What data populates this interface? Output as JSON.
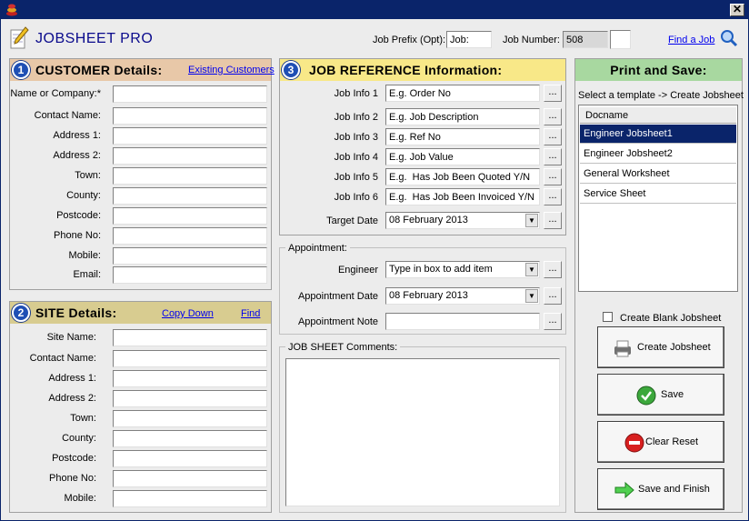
{
  "app": {
    "title": "JOBSHEET PRO",
    "close_glyph": "✕"
  },
  "header": {
    "job_prefix_label": "Job Prefix (Opt):",
    "job_prefix_value": "Job:",
    "job_number_label": "Job Number:",
    "job_number_value": "508",
    "find_job_link": "Find a Job"
  },
  "customer": {
    "badge": "1",
    "title": "CUSTOMER Details:",
    "existing_link": "Existing Customers",
    "fields": [
      {
        "label": "Name or Company:*",
        "value": ""
      },
      {
        "label": "Contact Name:",
        "value": ""
      },
      {
        "label": "Address 1:",
        "value": ""
      },
      {
        "label": "Address 2:",
        "value": ""
      },
      {
        "label": "Town:",
        "value": ""
      },
      {
        "label": "County:",
        "value": ""
      },
      {
        "label": "Postcode:",
        "value": ""
      },
      {
        "label": "Phone No:",
        "value": ""
      },
      {
        "label": "Mobile:",
        "value": ""
      },
      {
        "label": "Email:",
        "value": ""
      }
    ]
  },
  "site": {
    "badge": "2",
    "title": "SITE Details:",
    "copy_down_link": "Copy Down",
    "find_link": "Find",
    "fields": [
      {
        "label": "Site Name:",
        "value": ""
      },
      {
        "label": "Contact Name:",
        "value": ""
      },
      {
        "label": "Address 1:",
        "value": ""
      },
      {
        "label": "Address 2:",
        "value": ""
      },
      {
        "label": "Town:",
        "value": ""
      },
      {
        "label": "County:",
        "value": ""
      },
      {
        "label": "Postcode:",
        "value": ""
      },
      {
        "label": "Phone No:",
        "value": ""
      },
      {
        "label": "Mobile:",
        "value": ""
      }
    ]
  },
  "job_ref": {
    "badge": "3",
    "title": "JOB REFERENCE Information:",
    "dots_label": "...",
    "infos": [
      {
        "label": "Job Info 1",
        "value": "E.g. Order No"
      },
      {
        "label": "Job Info 2",
        "value": "E.g. Job Description"
      },
      {
        "label": "Job Info 3",
        "value": "E.g. Ref No"
      },
      {
        "label": "Job Info 4",
        "value": "E.g. Job Value"
      },
      {
        "label": "Job Info 5",
        "value": "E.g.  Has Job Been Quoted Y/N"
      },
      {
        "label": "Job Info 6",
        "value": "E.g.  Has Job Been Invoiced Y/N"
      }
    ],
    "target_date_label": "Target Date",
    "target_date_value": "08  February  2013"
  },
  "appointment": {
    "legend": "Appointment:",
    "engineer_label": "Engineer",
    "engineer_value": "Type in box to add item",
    "date_label": "Appointment Date",
    "date_value": "08  February  2013",
    "note_label": "Appointment Note",
    "note_value": ""
  },
  "comments": {
    "legend": "JOB SHEET Comments:",
    "value": ""
  },
  "print_save": {
    "title": "Print and Save:",
    "instruction": "Select a template -> Create Jobsheet",
    "list_header": "Docname",
    "templates": [
      "Engineer Jobsheet1",
      "Engineer Jobsheet2",
      "General Worksheet",
      "Service Sheet"
    ],
    "selected_index": 0,
    "blank_checkbox_label": "Create Blank Jobsheet",
    "create_button": "Create Jobsheet",
    "save_button": "Save",
    "clear_button": "Clear Reset",
    "finish_button": "Save and Finish"
  },
  "colors": {
    "titlebar": "#0a246a",
    "customer_header": "#e8c8a8",
    "site_header": "#d8cc90",
    "jobref_header": "#f8e888",
    "print_header": "#a8d8a0",
    "selection": "#0a246a",
    "link": "#0000ee"
  }
}
